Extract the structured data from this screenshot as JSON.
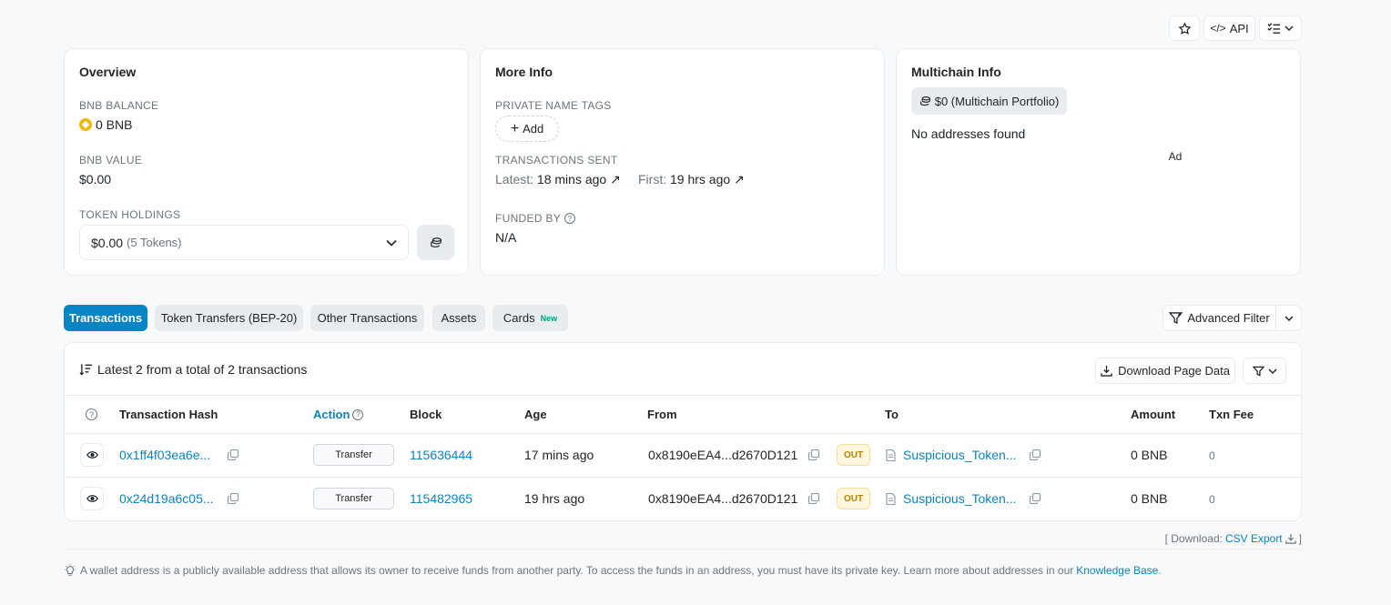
{
  "topbar": {
    "api_label": "API"
  },
  "overview": {
    "title": "Overview",
    "bnb_balance_label": "BNB BALANCE",
    "bnb_balance_value": "0 BNB",
    "bnb_value_label": "BNB VALUE",
    "bnb_value_value": "$0.00",
    "token_holdings_label": "TOKEN HOLDINGS",
    "token_holdings_value": "$0.00",
    "token_holdings_count": "(5 Tokens)"
  },
  "more_info": {
    "title": "More Info",
    "private_tags_label": "PRIVATE NAME TAGS",
    "add_label": "Add",
    "tx_sent_label": "TRANSACTIONS SENT",
    "latest_label": "Latest:",
    "latest_value": "18 mins ago",
    "first_label": "First:",
    "first_value": "19 hrs ago",
    "funded_by_label": "FUNDED BY",
    "funded_by_value": "N/A"
  },
  "multichain": {
    "title": "Multichain Info",
    "portfolio_label": "$0 (Multichain Portfolio)",
    "no_addresses": "No addresses found",
    "ad_label": "Ad"
  },
  "tabs": [
    {
      "label": "Transactions"
    },
    {
      "label": "Token Transfers (BEP-20)"
    },
    {
      "label": "Other Transactions"
    },
    {
      "label": "Assets"
    },
    {
      "label": "Cards"
    }
  ],
  "cards_badge": "New",
  "advanced_filter_label": "Advanced Filter",
  "table": {
    "summary": "Latest 2 from a total of 2 transactions",
    "download_label": "Download Page Data",
    "headers": {
      "hash": "Transaction Hash",
      "action": "Action",
      "block": "Block",
      "age": "Age",
      "from": "From",
      "to": "To",
      "amount": "Amount",
      "fee": "Txn Fee"
    },
    "rows": [
      {
        "hash": "0x1ff4f03ea6e...",
        "action": "Transfer",
        "block": "115636444",
        "age": "17 mins ago",
        "from": "0x8190eEA4...d2670D121",
        "direction": "OUT",
        "to": "Suspicious_Token...",
        "amount": "0 BNB",
        "fee": "0"
      },
      {
        "hash": "0x24d19a6c05...",
        "action": "Transfer",
        "block": "115482965",
        "age": "19 hrs ago",
        "from": "0x8190eEA4...d2670D121",
        "direction": "OUT",
        "to": "Suspicious_Token...",
        "amount": "0 BNB",
        "fee": "0"
      }
    ]
  },
  "download": {
    "prefix": "[ Download:",
    "link": "CSV Export",
    "suffix": "]"
  },
  "footer": {
    "text": "A wallet address is a publicly available address that allows its owner to receive funds from another party. To access the funds in an address, you must have its private key. Learn more about addresses in our",
    "link": "Knowledge Base",
    "end": "."
  },
  "colors": {
    "accent": "#0784c3",
    "out_badge": "#b78103",
    "bnb": "#f0b90b"
  },
  "icons": [
    "star-icon",
    "code-icon",
    "list-check-icon",
    "chevron-down-icon",
    "bnb-icon",
    "coins-icon",
    "plus-icon",
    "arrow-up-right-icon",
    "question-icon",
    "filter-icon",
    "sort-icon",
    "download-icon",
    "eye-icon",
    "copy-icon",
    "contract-icon",
    "bulb-icon"
  ]
}
